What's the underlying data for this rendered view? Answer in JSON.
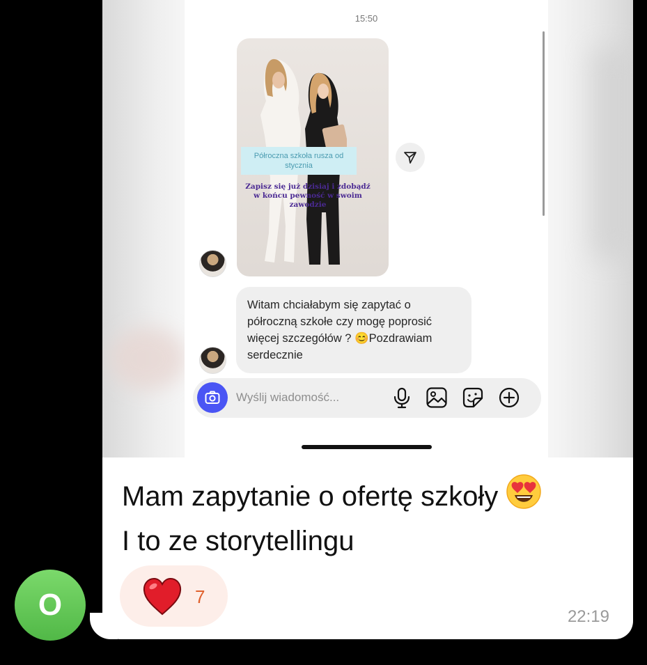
{
  "screenshot": {
    "timestamp": "15:50",
    "story": {
      "caption_top": "Półroczna szkoła rusza od stycznia",
      "caption_bottom": "Zapisz się już dzisiaj i zdobądź w końcu pewność w swoim zawodzie"
    },
    "incoming_message": "Witam chciałabym się zapytać o półroczną szkołe czy mogę poprosić więcej szczegółów ? 😊Pozdrawiam serdecznie",
    "input_placeholder": "Wyślij wiadomość...",
    "icons": [
      "camera-icon",
      "microphone-icon",
      "gallery-icon",
      "sticker-icon",
      "plus-icon",
      "share-icon"
    ],
    "accent_color": "#4a55f4"
  },
  "message": {
    "line1": "Mam zapytanie o ofertę szkoły",
    "line1_emoji": "😍",
    "line2": "I to ze storytellingu",
    "reaction_emoji": "heart",
    "reaction_count": "7",
    "time": "22:19"
  },
  "sender": {
    "initial": "O",
    "avatar_color": "#5fc552"
  }
}
